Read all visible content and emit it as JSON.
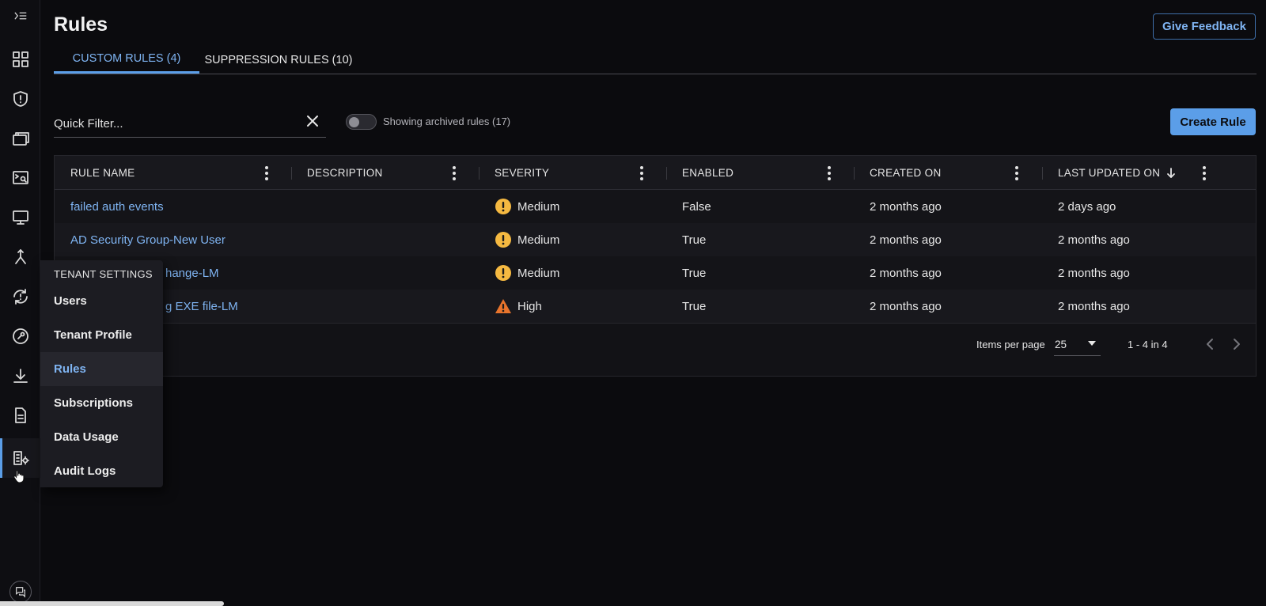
{
  "header": {
    "title": "Rules",
    "feedback_label": "Give Feedback"
  },
  "tabs": [
    {
      "label": "CUSTOM RULES (4)",
      "active": true
    },
    {
      "label": "SUPPRESSION RULES (10)",
      "active": false
    }
  ],
  "filter": {
    "placeholder": "Quick Filter...",
    "value": ""
  },
  "archived_toggle": {
    "label": "Showing archived rules (17)",
    "on": false
  },
  "create_label": "Create Rule",
  "table": {
    "columns": [
      "RULE NAME",
      "DESCRIPTION",
      "SEVERITY",
      "ENABLED",
      "CREATED ON",
      "LAST UPDATED ON"
    ],
    "rows": [
      {
        "name": "failed auth events",
        "description": "",
        "severity": "Medium",
        "enabled": "False",
        "created": "2 months ago",
        "updated": "2 days ago"
      },
      {
        "name": "AD Security Group-New User",
        "description": "",
        "severity": "Medium",
        "enabled": "True",
        "created": "2 months ago",
        "updated": "2 months ago"
      },
      {
        "name": "hange-LM",
        "description": "",
        "severity": "Medium",
        "enabled": "True",
        "created": "2 months ago",
        "updated": "2 months ago"
      },
      {
        "name": "g EXE file-LM",
        "description": "",
        "severity": "High",
        "enabled": "True",
        "created": "2 months ago",
        "updated": "2 months ago"
      }
    ]
  },
  "pager": {
    "items_label": "Items per page",
    "page_size": "25",
    "range": "1 - 4 in 4"
  },
  "flyout": {
    "title": "TENANT SETTINGS",
    "items": [
      {
        "label": "Users",
        "active": false
      },
      {
        "label": "Tenant Profile",
        "active": false
      },
      {
        "label": "Rules",
        "active": true
      },
      {
        "label": "Subscriptions",
        "active": false
      },
      {
        "label": "Data Usage",
        "active": false
      },
      {
        "label": "Audit Logs",
        "active": false
      }
    ]
  },
  "rail_icons": [
    "expand-nav-icon",
    "dashboard-icon",
    "shield-alert-icon",
    "cases-icon",
    "search-terminal-icon",
    "monitor-icon",
    "merge-icon",
    "sync-alert-icon",
    "wrench-icon",
    "download-icon",
    "document-icon",
    "tenant-settings-icon",
    "chat-icon"
  ],
  "colors": {
    "accent": "#5b9ee8",
    "medium": "#f5b941",
    "high": "#e8742c",
    "background": "#0b0b0e"
  }
}
